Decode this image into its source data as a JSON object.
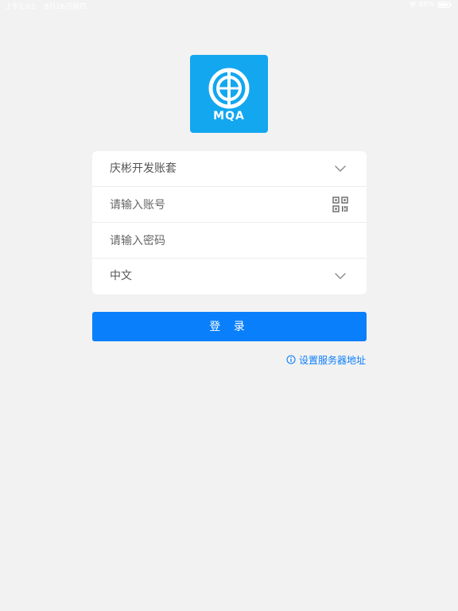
{
  "status_bar": {
    "time": "上午1:03",
    "date": "8月26日周四",
    "battery": "88%"
  },
  "app": {
    "logo_text": "MQA",
    "brand_color": "#13a7f0",
    "accent_color": "#0a7ffb"
  },
  "form": {
    "account_set": "庆彬开发账套",
    "account_placeholder": "请输入账号",
    "password_placeholder": "请输入密码",
    "language": "中文"
  },
  "actions": {
    "login_label": "登 录",
    "server_link_label": "设置服务器地址"
  },
  "icons": {
    "dropdown": "chevron-down-icon",
    "scan": "qr-code-icon",
    "info": "info-icon",
    "wifi": "wifi-icon",
    "battery": "battery-icon"
  }
}
